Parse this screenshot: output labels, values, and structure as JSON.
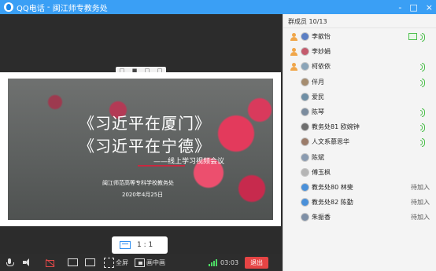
{
  "window": {
    "title": "QQ电话",
    "group_name": "闽江师专教务处",
    "controls": [
      "-",
      "□",
      "×"
    ]
  },
  "toolbar_top": {
    "items": [
      "□",
      "■",
      "□",
      "□"
    ]
  },
  "slide": {
    "title_line1": "《习近平在厦门》",
    "title_line2": "《习近平在宁德》",
    "subtitle": "——线上学习视频会议",
    "org": "闽江师范高等专科学校教务处",
    "date": "2020年4月25日"
  },
  "ratio_button": {
    "label": "1 : 1"
  },
  "bottom_bar": {
    "fullscreen_label": "全屏",
    "pip_label": "画中画",
    "timer": "03:03",
    "exit_label": "退出"
  },
  "panel": {
    "header": "群成员 10/13",
    "members": [
      {
        "name": "李歆怡",
        "role": "owner",
        "status": "",
        "screen": true
      },
      {
        "name": "李妙娟",
        "role": "owner",
        "status": "",
        "screen": false
      },
      {
        "name": "柯依依",
        "role": "owner",
        "status": "",
        "screen": false,
        "speaking": true
      },
      {
        "name": "伴月",
        "role": "",
        "status": "",
        "speaking": true
      },
      {
        "name": "爱民",
        "role": "",
        "status": ""
      },
      {
        "name": "陈琴",
        "role": "",
        "status": "",
        "speaking": true
      },
      {
        "name": "教务处81 欧婉钟",
        "role": "",
        "status": "",
        "speaking": true
      },
      {
        "name": "人文系慕思华",
        "role": "",
        "status": "",
        "speaking": true
      },
      {
        "name": "陈斌",
        "role": "",
        "status": ""
      },
      {
        "name": "傅玉枫",
        "role": "",
        "status": ""
      },
      {
        "name": "教务处80 林斐",
        "role": "",
        "status": "待加入"
      },
      {
        "name": "教务处82 陈勤",
        "role": "",
        "status": "待加入"
      },
      {
        "name": "朱振香",
        "role": "",
        "status": "待加入"
      }
    ]
  },
  "colors": {
    "titlebar": "#3a9ff5",
    "exit": "#e64444",
    "speaking": "#4cbf4c"
  }
}
